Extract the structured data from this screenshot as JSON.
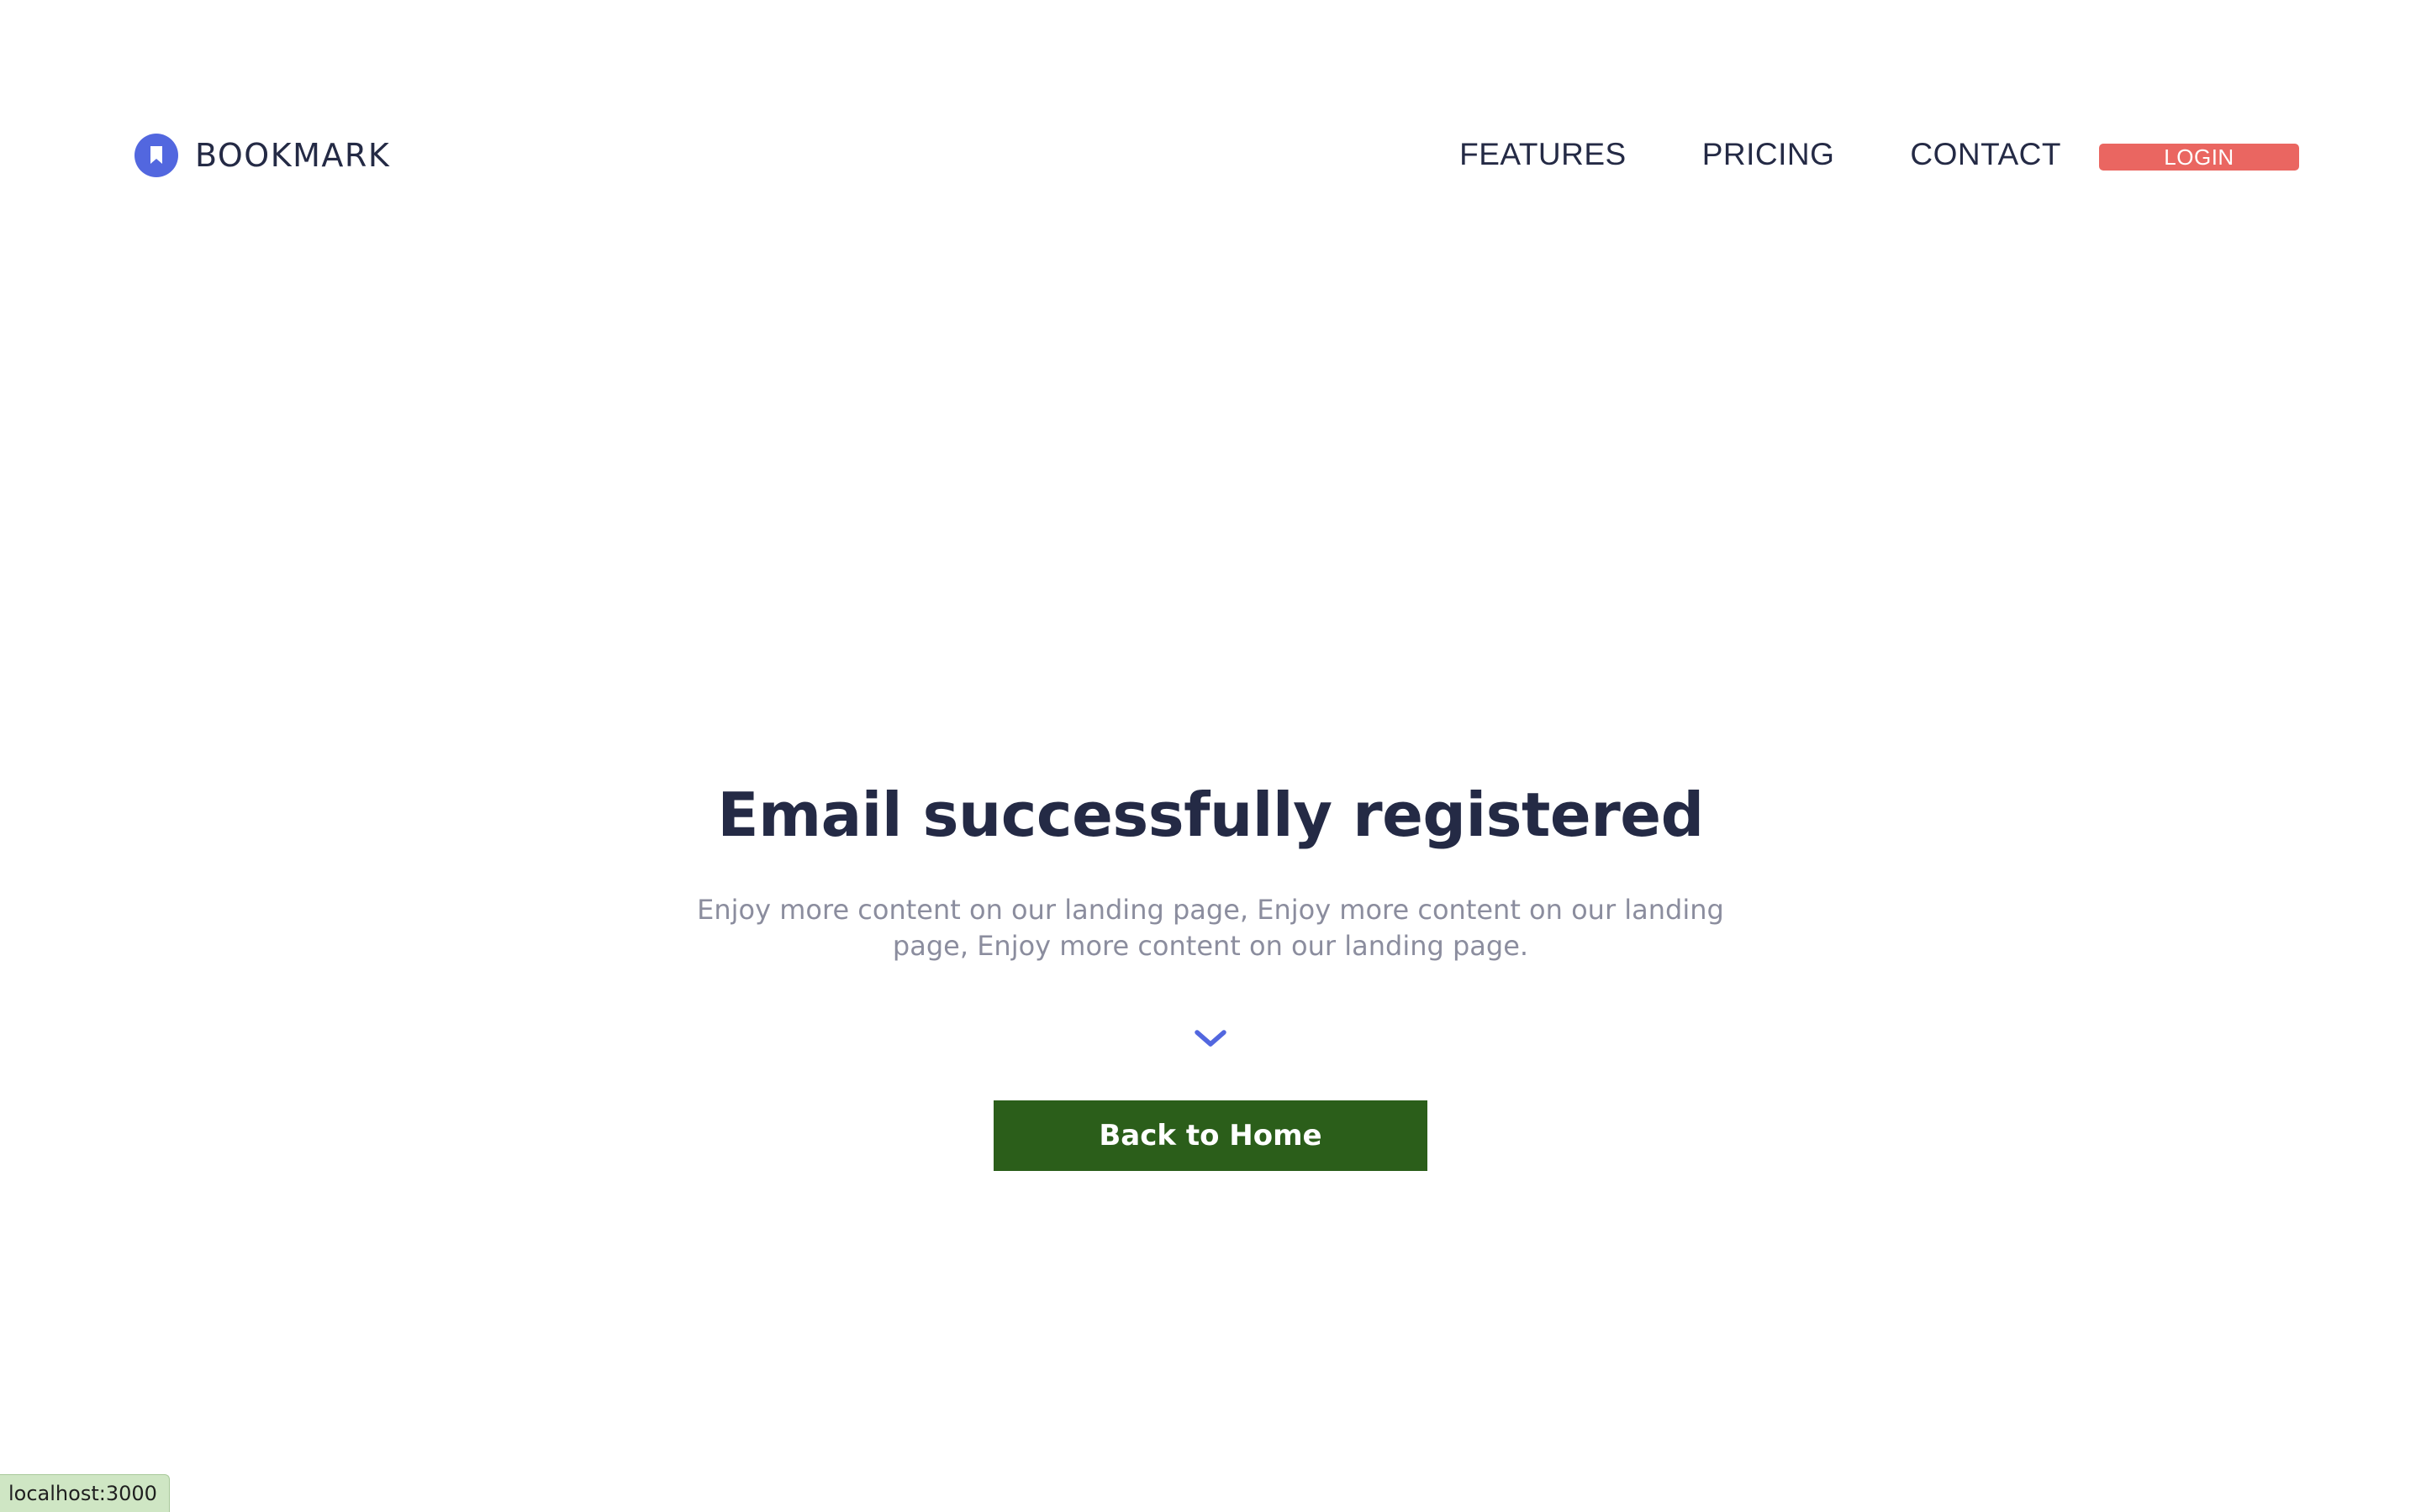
{
  "brand": {
    "name": "BOOKMARK",
    "icon": "bookmark-icon",
    "color": "#5267df"
  },
  "nav": {
    "links": [
      "FEATURES",
      "PRICING",
      "CONTACT"
    ],
    "login_label": "LOGIN",
    "login_color": "#ea6661"
  },
  "hero": {
    "title": "Email successfully registered",
    "text": "Enjoy more content on our landing page, Enjoy more content on our landing page, Enjoy more content on our landing page.",
    "scroll_icon": "chevron-down-icon",
    "button_label": "Back to Home",
    "button_color": "#2b5e1a"
  },
  "status_bar": {
    "url": "localhost:3000"
  }
}
